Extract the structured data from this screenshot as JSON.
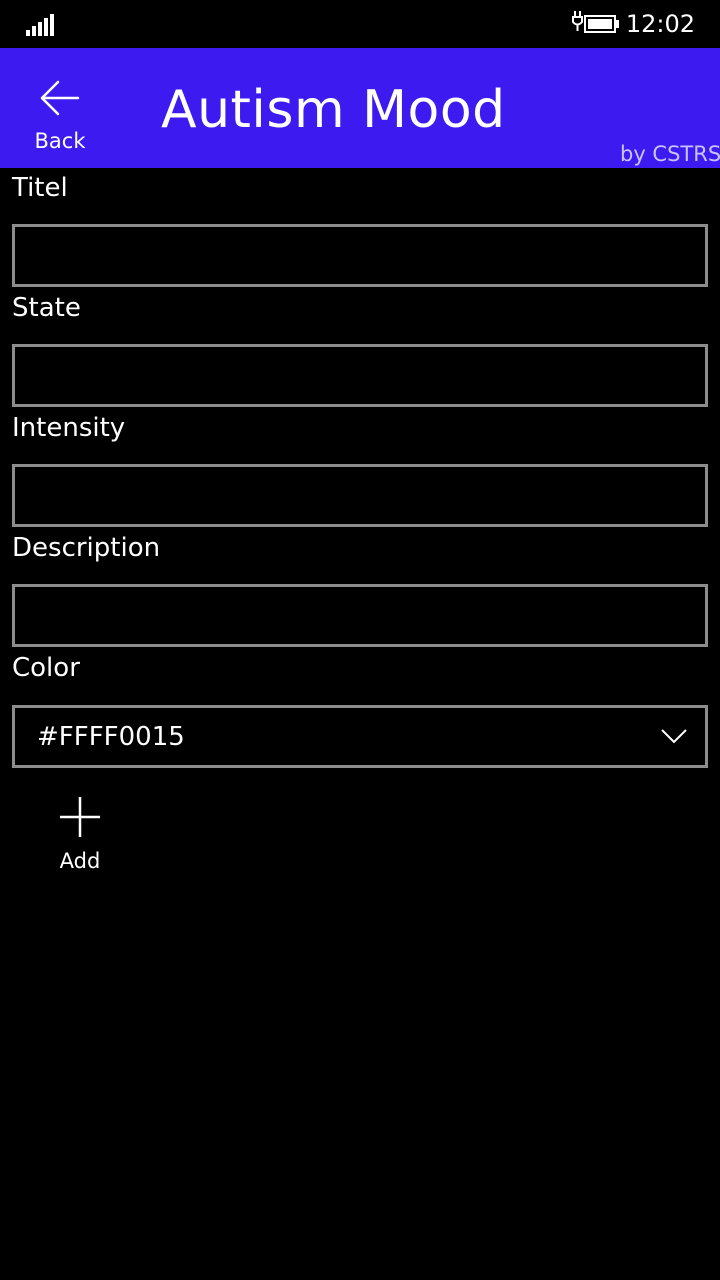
{
  "status_bar": {
    "time": "12:02",
    "signal_icon": "signal-strength-icon",
    "battery_icon": "battery-charging-icon"
  },
  "header": {
    "back_label": "Back",
    "title": "Autism Mood",
    "byline": "by CSTRSK",
    "background_color": "#3d1bf0"
  },
  "form": {
    "title_label": "Titel",
    "title_value": "",
    "state_label": "State",
    "state_value": "",
    "intensity_label": "Intensity",
    "intensity_value": "",
    "description_label": "Description",
    "description_value": "",
    "color_label": "Color",
    "color_value": "#FFFF0015"
  },
  "actions": {
    "add_label": "Add"
  }
}
